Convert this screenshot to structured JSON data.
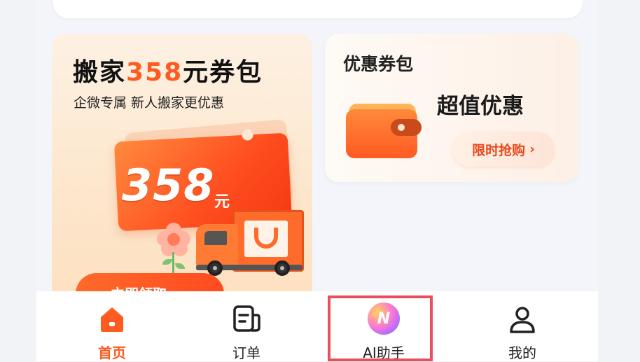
{
  "promo_left": {
    "title_prefix": "搬家",
    "title_number": "358",
    "title_suffix": "元券包",
    "subtitle": "企微专属 新人搬家更优惠",
    "ticket_amount": "358",
    "ticket_unit": "元",
    "cta_label": "立即领取",
    "colors": {
      "accent": "#ff5a1f",
      "ticket": "#ff4d1f"
    }
  },
  "promo_right": {
    "title": "优惠券包",
    "headline": "超值优惠",
    "button_label": "限时抢购",
    "button_chevron": "›"
  },
  "tabbar": {
    "items": [
      {
        "label": "首页",
        "icon": "home-icon",
        "active": true
      },
      {
        "label": "订单",
        "icon": "orders-icon",
        "active": false
      },
      {
        "label": "AI助手",
        "icon": "ai-assistant-icon",
        "active": false
      },
      {
        "label": "我的",
        "icon": "profile-icon",
        "active": false
      }
    ],
    "active_color": "#ff5a1f",
    "highlight_color": "#e8505b"
  }
}
